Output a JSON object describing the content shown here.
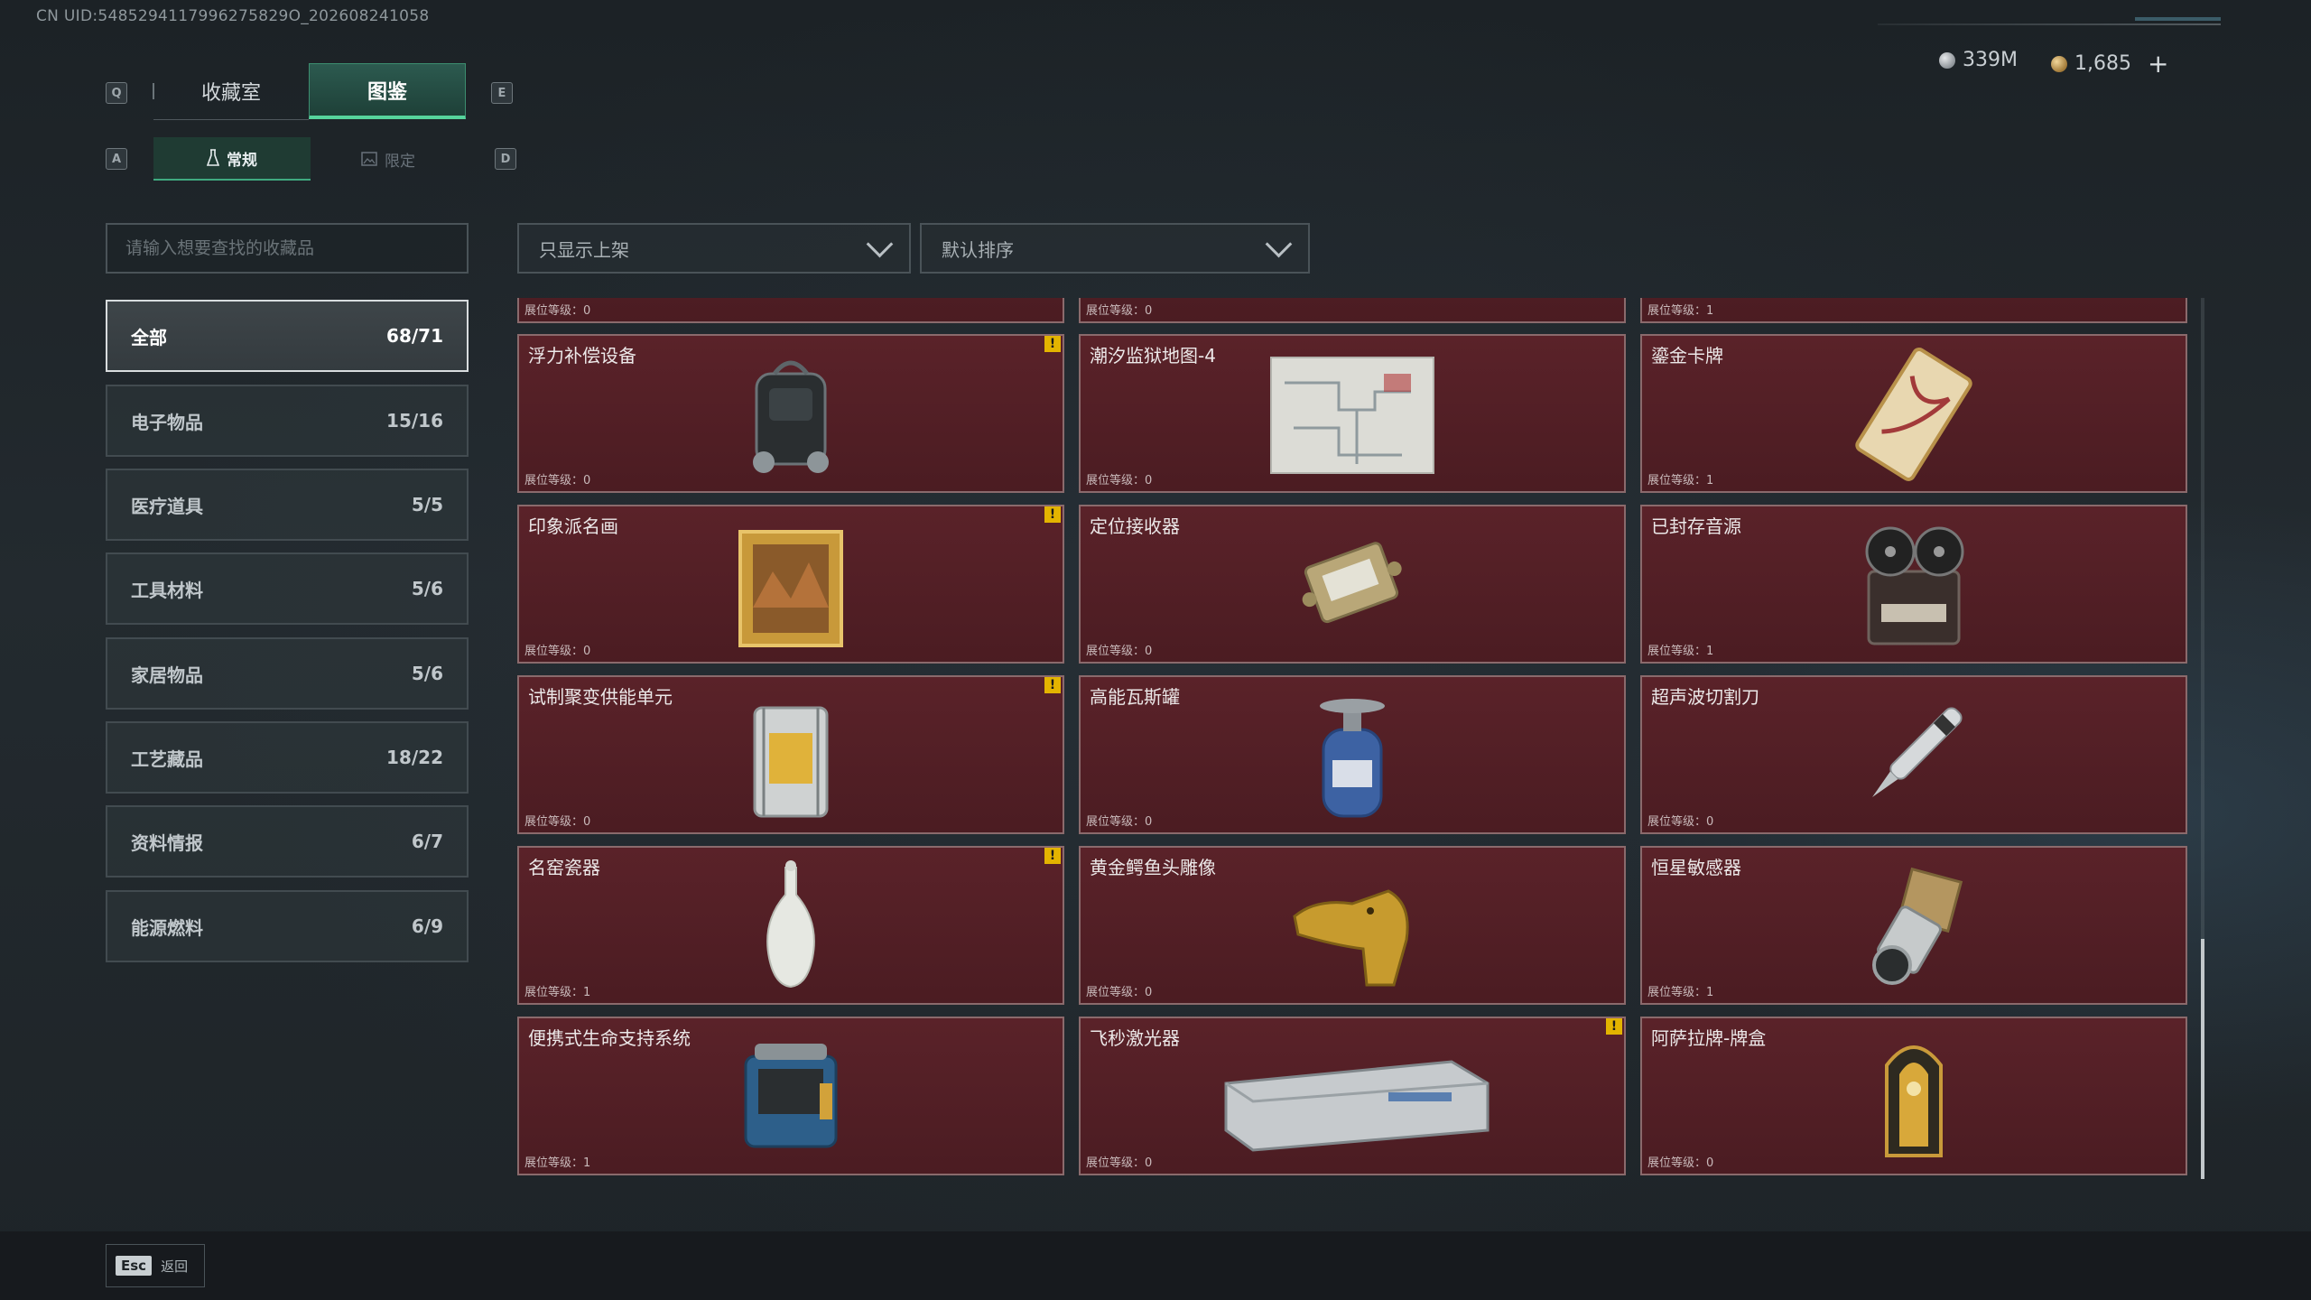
{
  "header": {
    "uid": "CN UID:5485294117996275829O_202608241058",
    "currency": [
      {
        "icon": "silver-coin-icon",
        "value": "339M"
      },
      {
        "icon": "gold-coin-icon",
        "value": "1,685"
      }
    ],
    "plus_label": "+"
  },
  "keys": {
    "q": "Q",
    "e": "E",
    "a": "A",
    "d": "D"
  },
  "tabs": [
    {
      "label": "收藏室",
      "active": false
    },
    {
      "label": "图鉴",
      "active": true
    }
  ],
  "subtabs": [
    {
      "label": "常规",
      "icon": "flask-icon",
      "active": true
    },
    {
      "label": "限定",
      "icon": "image-icon",
      "active": false
    }
  ],
  "search": {
    "placeholder": "请输入想要查找的收藏品"
  },
  "categories": [
    {
      "label": "全部",
      "count": "68/71",
      "active": true
    },
    {
      "label": "电子物品",
      "count": "15/16"
    },
    {
      "label": "医疗道具",
      "count": "5/5"
    },
    {
      "label": "工具材料",
      "count": "5/6"
    },
    {
      "label": "家居物品",
      "count": "5/6"
    },
    {
      "label": "工艺藏品",
      "count": "18/22"
    },
    {
      "label": "资料情报",
      "count": "6/7"
    },
    {
      "label": "能源燃料",
      "count": "6/9"
    }
  ],
  "filters": {
    "shelf": "只显示上架",
    "sort": "默认排序"
  },
  "level_prefix": "展位等级：",
  "partial_row": [
    {
      "level": "0"
    },
    {
      "level": "0"
    },
    {
      "level": "1"
    }
  ],
  "items": [
    {
      "name": "浮力补偿设备",
      "level": "0",
      "warn": true,
      "icon": "buoyancy-device-icon"
    },
    {
      "name": "潮汐监狱地图-4",
      "level": "0",
      "warn": false,
      "icon": "prison-map-icon"
    },
    {
      "name": "鎏金卡牌",
      "level": "1",
      "warn": false,
      "icon": "gilded-card-icon"
    },
    {
      "name": "印象派名画",
      "level": "0",
      "warn": true,
      "icon": "framed-painting-icon"
    },
    {
      "name": "定位接收器",
      "level": "0",
      "warn": false,
      "icon": "locator-receiver-icon"
    },
    {
      "name": "已封存音源",
      "level": "1",
      "warn": false,
      "icon": "reel-recorder-icon"
    },
    {
      "name": "试制聚变供能单元",
      "level": "0",
      "warn": true,
      "icon": "fusion-unit-icon"
    },
    {
      "name": "高能瓦斯罐",
      "level": "0",
      "warn": false,
      "icon": "gas-canister-icon"
    },
    {
      "name": "超声波切割刀",
      "level": "0",
      "warn": false,
      "icon": "ultrasonic-cutter-icon"
    },
    {
      "name": "名窑瓷器",
      "level": "1",
      "warn": true,
      "icon": "porcelain-vase-icon"
    },
    {
      "name": "黄金鳄鱼头雕像",
      "level": "0",
      "warn": false,
      "icon": "gold-crocodile-icon"
    },
    {
      "name": "恒星敏感器",
      "level": "1",
      "warn": false,
      "icon": "star-sensor-icon"
    },
    {
      "name": "便携式生命支持系统",
      "level": "1",
      "warn": false,
      "icon": "life-support-icon"
    },
    {
      "name": "飞秒激光器",
      "level": "0",
      "warn": true,
      "icon": "femtosecond-laser-icon"
    },
    {
      "name": "阿萨拉牌-牌盒",
      "level": "0",
      "warn": false,
      "icon": "card-box-icon"
    }
  ],
  "footer": {
    "esc_key": "Esc",
    "back_label": "返回"
  },
  "colors": {
    "accent": "#56d39c",
    "cell_bg": "#541f26",
    "warn": "#e3b400"
  }
}
